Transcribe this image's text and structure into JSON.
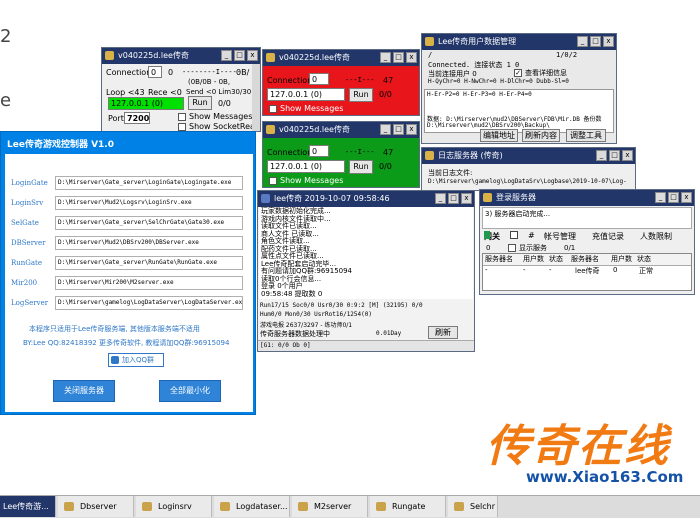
{
  "win_small": {
    "title": "v040225d.lee传奇",
    "connections_label": "Connections",
    "connections_value": "0",
    "conn_range": "0",
    "conn_mark": "--------I------",
    "top_right": "0B/",
    "loop_text": "Loop <43",
    "rece_text": "Rece <0",
    "send_text": "Send <0 Lim30/30",
    "bytes_text": "(0B/0B - 0B,",
    "ip_select": "127.0.0.1 (0)",
    "run_label": "Run",
    "count": "0/0",
    "port_label": "Port",
    "port_value": "7200",
    "show_messages": "Show Messages",
    "show_socketread": "Show SocketRead"
  },
  "win_red": {
    "title": "v040225d.lee传奇",
    "connections_label": "Connections",
    "connections_value": "0",
    "mark": "---I---",
    "right_num": "47",
    "ip_select": "127.0.0.1 (0)",
    "run_label": "Run",
    "count": "0/0",
    "show_messages": "Show Messages"
  },
  "win_green": {
    "title": "v040225d.lee传奇",
    "connections_label": "Connections",
    "connections_value": "0",
    "mark": "---I---",
    "right_num": "47",
    "ip_select": "127.0.0.1 (0)",
    "run_label": "Run",
    "count": "0/0",
    "show_messages": "Show Messages"
  },
  "win_userdb": {
    "title": "Lee传奇用户数据管理",
    "slash": "/",
    "pager": "1/0/2",
    "status_line": "Connected.        连接状态 1    0",
    "current_conn": "当前连接用户  0",
    "view_detail": "查看详细信息",
    "stats_line": "H-QyChr=0  H-NwChr=0  H-DlChr=0  Dubb-Sl=0",
    "stats_line2": "H-Er-P2=0  H-Er-P3=0  H-Er-P4=0",
    "path_line1": "数据: D:\\Mirserver\\mud2\\DBServer\\FDB\\Mir.DB   备份数",
    "path_line2": "D:\\Mirserver\\mud2\\DBSrv200\\Backup\\",
    "btn_edit": "编辑地址",
    "btn_refresh": "刷新内容",
    "btn_tools": "调整工具"
  },
  "win_log": {
    "title": "日志服务器 (传奇)",
    "line1": "当前日志文件:",
    "line2": "D:\\Mirserver\\gamelog\\LogDataSrv\\Logbase\\2019-10-07\\Log-"
  },
  "win_login": {
    "title": "登录服务器",
    "message": "3) 服务器启动完成...",
    "tabs": [
      "网关",
      "#",
      "帐号管理",
      "充值记录",
      "人数限制"
    ],
    "gw_count": "0",
    "show_server": "显示服务",
    "show_count": "0/1",
    "columns": [
      "服务器名",
      "用户数",
      "状态",
      "服务器名",
      "用户数",
      "状态"
    ],
    "row": [
      "-",
      "-",
      "-",
      "lee传奇",
      "0",
      "正常"
    ]
  },
  "win_m2": {
    "title": "lee传奇 2019-10-07 09:58:46",
    "log_lines": [
      "玩家数据初始化完成...",
      "游戏内核文件读取中...",
      "读取文件已读取...",
      "商人文件 已读取...",
      "角色文件读取...",
      "配药文件已读取...",
      "属性点文件已读取...",
      "Lee传奇配套启动完毕...",
      "有问题请加QQ群:96915094",
      "读取0个行会信息...",
      "登录 0个用户",
      "09:58:48 提取数 0"
    ],
    "stat1": "Run17/15 Soc0/0 Usr0/30  0:9:2 [M]        (32195)    0/0",
    "stat2": "Hum0/0 Mon0/30 UsrRot16/1254(0)",
    "stat3": "游戏电报 2637/3297 - 练功师0/1",
    "stat4": "传奇服务器数据处理中",
    "stat4_right": "0.01Day",
    "refresh_btn": "刷新",
    "status_bar": "[G1: 0/0 Ob 0]"
  },
  "controller": {
    "title": "Lee传奇游戏控制器  V1.0",
    "rows": [
      {
        "label": "LoginGate",
        "path": "D:\\Mirserver\\Gate_server\\LoginGate\\Logingate.exe"
      },
      {
        "label": "LoginSrv",
        "path": "D:\\Mirserver\\Mud2\\Logsrv\\LoginSrv.exe"
      },
      {
        "label": "SelGate",
        "path": "D:\\Mirserver\\Gate_server\\SelChrGate\\Gate30.exe"
      },
      {
        "label": "DBServer",
        "path": "D:\\Mirserver\\Mud2\\DBSrv200\\DBServer.exe"
      },
      {
        "label": "RunGate",
        "path": "D:\\Mirserver\\Gate_server\\RunGate\\RunGate.exe"
      },
      {
        "label": "Mir200",
        "path": "D:\\Mirserver\\Mir200\\M2server.exe"
      },
      {
        "label": "LogServer",
        "path": "D:\\Mirserver\\gamelog\\LogDataServer\\LogDataServer.exe"
      }
    ],
    "notice": "本程序只适用于Lee传奇服务端, 其他版本服务端不适用",
    "contact": "BY:Lee    QQ:82418392    更多传奇软件, 教程请加QQ群:96915094",
    "join_qq": "加入QQ群",
    "btn_close": "关闭服务器",
    "btn_minimize": "全部最小化"
  },
  "watermark": {
    "big_text": "传奇在线",
    "url": "www.Xiao163.Com"
  },
  "taskbar": [
    {
      "label": "Lee传奇游..."
    },
    {
      "label": "Dbserver"
    },
    {
      "label": "Loginsrv"
    },
    {
      "label": "Logdataser..."
    },
    {
      "label": "M2server"
    },
    {
      "label": "Rungate"
    },
    {
      "label": "Selchr"
    }
  ],
  "colors": {
    "titlebar": "#22366a",
    "red_panel": "#e8161b",
    "green_panel": "#0c9a19",
    "controller_bg": "#0081e6",
    "accent_blue": "#2f78c8",
    "watermark_orange": "#f17a12",
    "watermark_url": "#1452a8"
  }
}
